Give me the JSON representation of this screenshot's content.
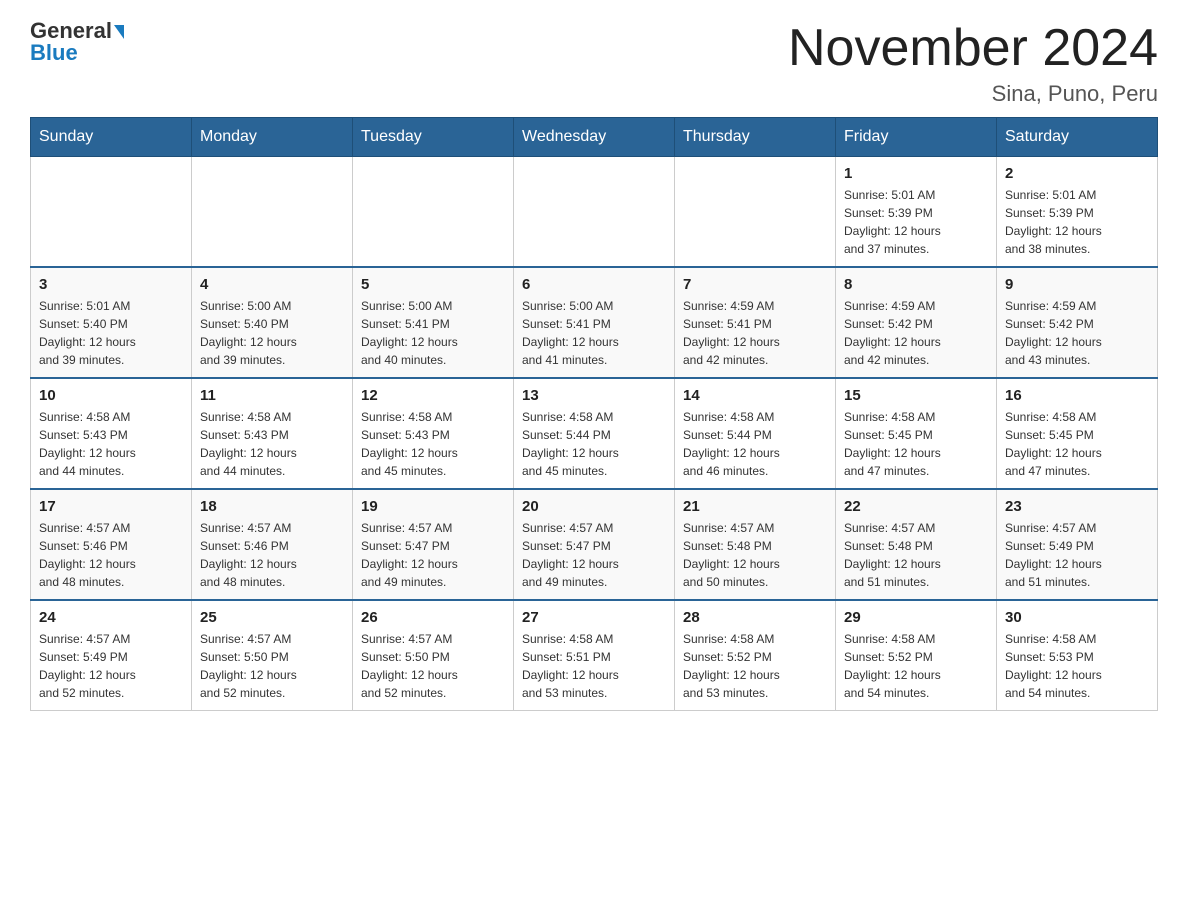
{
  "logo": {
    "general": "General",
    "blue": "Blue"
  },
  "title": "November 2024",
  "subtitle": "Sina, Puno, Peru",
  "days_of_week": [
    "Sunday",
    "Monday",
    "Tuesday",
    "Wednesday",
    "Thursday",
    "Friday",
    "Saturday"
  ],
  "weeks": [
    [
      {
        "day": "",
        "info": ""
      },
      {
        "day": "",
        "info": ""
      },
      {
        "day": "",
        "info": ""
      },
      {
        "day": "",
        "info": ""
      },
      {
        "day": "",
        "info": ""
      },
      {
        "day": "1",
        "info": "Sunrise: 5:01 AM\nSunset: 5:39 PM\nDaylight: 12 hours\nand 37 minutes."
      },
      {
        "day": "2",
        "info": "Sunrise: 5:01 AM\nSunset: 5:39 PM\nDaylight: 12 hours\nand 38 minutes."
      }
    ],
    [
      {
        "day": "3",
        "info": "Sunrise: 5:01 AM\nSunset: 5:40 PM\nDaylight: 12 hours\nand 39 minutes."
      },
      {
        "day": "4",
        "info": "Sunrise: 5:00 AM\nSunset: 5:40 PM\nDaylight: 12 hours\nand 39 minutes."
      },
      {
        "day": "5",
        "info": "Sunrise: 5:00 AM\nSunset: 5:41 PM\nDaylight: 12 hours\nand 40 minutes."
      },
      {
        "day": "6",
        "info": "Sunrise: 5:00 AM\nSunset: 5:41 PM\nDaylight: 12 hours\nand 41 minutes."
      },
      {
        "day": "7",
        "info": "Sunrise: 4:59 AM\nSunset: 5:41 PM\nDaylight: 12 hours\nand 42 minutes."
      },
      {
        "day": "8",
        "info": "Sunrise: 4:59 AM\nSunset: 5:42 PM\nDaylight: 12 hours\nand 42 minutes."
      },
      {
        "day": "9",
        "info": "Sunrise: 4:59 AM\nSunset: 5:42 PM\nDaylight: 12 hours\nand 43 minutes."
      }
    ],
    [
      {
        "day": "10",
        "info": "Sunrise: 4:58 AM\nSunset: 5:43 PM\nDaylight: 12 hours\nand 44 minutes."
      },
      {
        "day": "11",
        "info": "Sunrise: 4:58 AM\nSunset: 5:43 PM\nDaylight: 12 hours\nand 44 minutes."
      },
      {
        "day": "12",
        "info": "Sunrise: 4:58 AM\nSunset: 5:43 PM\nDaylight: 12 hours\nand 45 minutes."
      },
      {
        "day": "13",
        "info": "Sunrise: 4:58 AM\nSunset: 5:44 PM\nDaylight: 12 hours\nand 45 minutes."
      },
      {
        "day": "14",
        "info": "Sunrise: 4:58 AM\nSunset: 5:44 PM\nDaylight: 12 hours\nand 46 minutes."
      },
      {
        "day": "15",
        "info": "Sunrise: 4:58 AM\nSunset: 5:45 PM\nDaylight: 12 hours\nand 47 minutes."
      },
      {
        "day": "16",
        "info": "Sunrise: 4:58 AM\nSunset: 5:45 PM\nDaylight: 12 hours\nand 47 minutes."
      }
    ],
    [
      {
        "day": "17",
        "info": "Sunrise: 4:57 AM\nSunset: 5:46 PM\nDaylight: 12 hours\nand 48 minutes."
      },
      {
        "day": "18",
        "info": "Sunrise: 4:57 AM\nSunset: 5:46 PM\nDaylight: 12 hours\nand 48 minutes."
      },
      {
        "day": "19",
        "info": "Sunrise: 4:57 AM\nSunset: 5:47 PM\nDaylight: 12 hours\nand 49 minutes."
      },
      {
        "day": "20",
        "info": "Sunrise: 4:57 AM\nSunset: 5:47 PM\nDaylight: 12 hours\nand 49 minutes."
      },
      {
        "day": "21",
        "info": "Sunrise: 4:57 AM\nSunset: 5:48 PM\nDaylight: 12 hours\nand 50 minutes."
      },
      {
        "day": "22",
        "info": "Sunrise: 4:57 AM\nSunset: 5:48 PM\nDaylight: 12 hours\nand 51 minutes."
      },
      {
        "day": "23",
        "info": "Sunrise: 4:57 AM\nSunset: 5:49 PM\nDaylight: 12 hours\nand 51 minutes."
      }
    ],
    [
      {
        "day": "24",
        "info": "Sunrise: 4:57 AM\nSunset: 5:49 PM\nDaylight: 12 hours\nand 52 minutes."
      },
      {
        "day": "25",
        "info": "Sunrise: 4:57 AM\nSunset: 5:50 PM\nDaylight: 12 hours\nand 52 minutes."
      },
      {
        "day": "26",
        "info": "Sunrise: 4:57 AM\nSunset: 5:50 PM\nDaylight: 12 hours\nand 52 minutes."
      },
      {
        "day": "27",
        "info": "Sunrise: 4:58 AM\nSunset: 5:51 PM\nDaylight: 12 hours\nand 53 minutes."
      },
      {
        "day": "28",
        "info": "Sunrise: 4:58 AM\nSunset: 5:52 PM\nDaylight: 12 hours\nand 53 minutes."
      },
      {
        "day": "29",
        "info": "Sunrise: 4:58 AM\nSunset: 5:52 PM\nDaylight: 12 hours\nand 54 minutes."
      },
      {
        "day": "30",
        "info": "Sunrise: 4:58 AM\nSunset: 5:53 PM\nDaylight: 12 hours\nand 54 minutes."
      }
    ]
  ]
}
